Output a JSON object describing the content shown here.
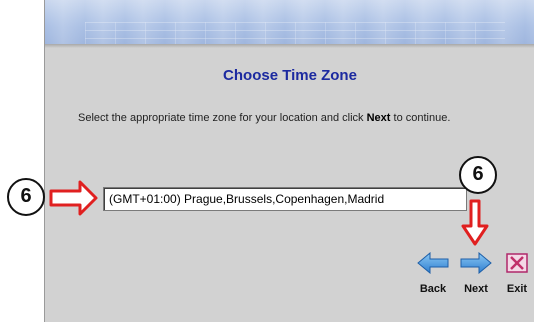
{
  "window": {
    "title": "Choose Time Zone",
    "instructions_pre": "Select the appropriate time zone for your location and click ",
    "instructions_bold": "Next",
    "instructions_post": " to continue."
  },
  "timezone_select": {
    "value": "(GMT+01:00) Prague,Brussels,Copenhagen,Madrid"
  },
  "navigation": {
    "back_label": "Back",
    "next_label": "Next",
    "exit_label": "Exit"
  },
  "callouts": {
    "left_number": "6",
    "right_number": "6"
  },
  "colors": {
    "title": "#1c2aa0",
    "background": "#d2d2d2",
    "arrow_blue": "#3c8fd8",
    "callout_arrow_red": "#e02020",
    "exit_icon": "#c0306a"
  },
  "icons": {
    "back": "back-arrow-icon",
    "next": "next-arrow-icon",
    "exit": "exit-x-icon"
  }
}
